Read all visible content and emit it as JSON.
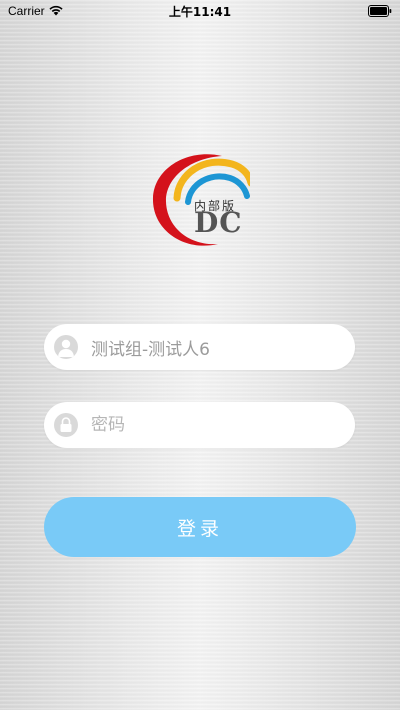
{
  "status_bar": {
    "carrier": "Carrier",
    "time": "上午11:41",
    "icons": [
      "wifi-icon",
      "battery-icon"
    ]
  },
  "logo": {
    "badge": "内部版",
    "mark": "DC",
    "arc_colors": [
      "#d4121b",
      "#f3b51d",
      "#1d96d4"
    ]
  },
  "form": {
    "username": {
      "value": "测试组-测试人6",
      "icon": "user-icon"
    },
    "password": {
      "placeholder": "密码",
      "icon": "lock-icon"
    },
    "login_label": "登录"
  },
  "colors": {
    "button": "#79caf7",
    "field_bg": "#ffffff",
    "icon_bg": "#d9d9d9"
  }
}
